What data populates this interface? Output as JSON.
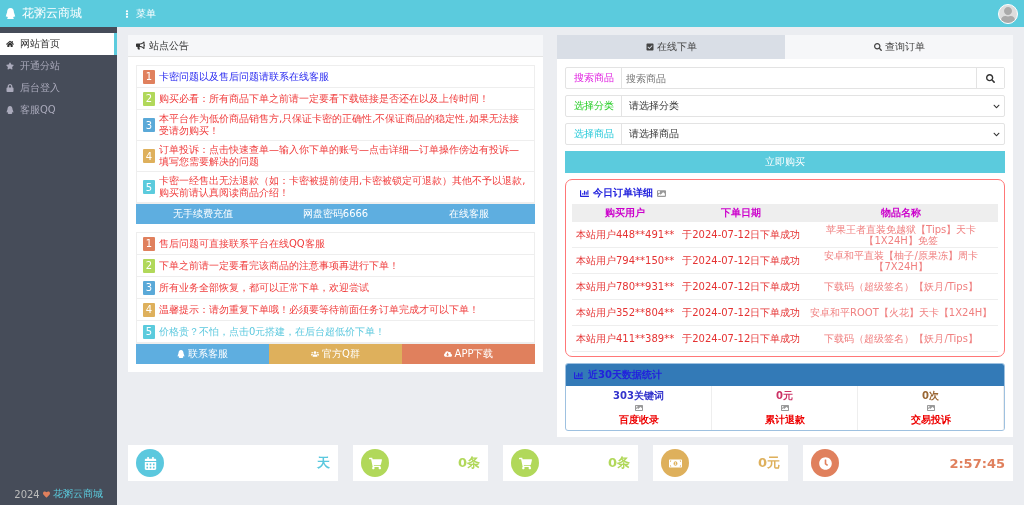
{
  "header": {
    "brand": "花粥云商城",
    "menu_label": "菜单"
  },
  "sidebar": {
    "items": [
      {
        "label": "网站首页",
        "selected": true
      },
      {
        "label": "开通分站",
        "selected": false
      },
      {
        "label": "后台登入",
        "selected": false
      },
      {
        "label": "客服QQ",
        "selected": false
      }
    ],
    "footer_year": "2024",
    "footer_link": "花粥云商城"
  },
  "notice_panel": {
    "title": "站点公告",
    "list_1": [
      {
        "number": "1",
        "text": "卡密问题以及售后问题请联系在线客服",
        "kind": "link"
      },
      {
        "number": "2",
        "text": "购买必看：所有商品下单之前请一定要看下载链接是否还在以及上传时间！",
        "kind": "warning"
      },
      {
        "number": "3",
        "text": "本平台作为低价商品销售方,只保证卡密的正确性,不保证商品的稳定性,如果无法接受请勿购买！",
        "kind": "warning"
      },
      {
        "number": "4",
        "text": "订单投诉：点击快速查单—输入你下单的账号—点击详细—订单操作傍边有投诉—填写您需要解决的问题",
        "kind": "warning"
      },
      {
        "number": "5",
        "text": "卡密一经售出无法退款（如：卡密被提前使用,卡密被锁定可退款）其他不予以退款,购买前请认真阅读商品介绍！",
        "kind": "warning"
      }
    ],
    "buttons_1": [
      "无手续费充值",
      "网盘密码6666",
      "在线客服"
    ],
    "list_2": [
      {
        "number": "1",
        "text": "售后问题可直接联系平台在线QQ客服",
        "kind": "warning"
      },
      {
        "number": "2",
        "text": "下单之前请一定要看完该商品的注意事项再进行下单！",
        "kind": "warning"
      },
      {
        "number": "3",
        "text": "所有业务全部恢复，都可以正常下单，欢迎尝试",
        "kind": "warning"
      },
      {
        "number": "4",
        "text": "温馨提示：请勿重复下单哦！必须要等待前面任务订单完成才可以下单！",
        "kind": "warning"
      },
      {
        "number": "5",
        "text": "价格贵？不怕，点击0元搭建，在后台超低价下单！",
        "kind": "tip"
      }
    ],
    "buttons_2": [
      "联系客服",
      "官方Q群",
      "APP下载"
    ]
  },
  "order_panel": {
    "tabs": [
      {
        "label": "在线下单",
        "selected": true
      },
      {
        "label": "查询订单",
        "selected": false
      }
    ],
    "search": {
      "label": "搜索商品",
      "placeholder": "搜索商品"
    },
    "category": {
      "label": "选择分类",
      "value": "请选择分类"
    },
    "product": {
      "label": "选择商品",
      "value": "请选择商品"
    },
    "buy_button": "立即购买",
    "today": {
      "title": "今日订单详细",
      "columns": [
        "购买用户",
        "下单日期",
        "物品名称"
      ],
      "rows": [
        [
          "本站用户448**491**",
          "于2024-07-12日下单成功",
          "苹果王者直装免越狱【Tips】天卡【1X24H】免签"
        ],
        [
          "本站用户794**150**",
          "于2024-07-12日下单成功",
          "安卓和平直装【柚子/原果冻】周卡【7X24H】"
        ],
        [
          "本站用户780**931**",
          "于2024-07-12日下单成功",
          "下载码（超级签名）【妖月/Tips】"
        ],
        [
          "本站用户352**804**",
          "于2024-07-12日下单成功",
          "安卓和平ROOT【火花】天卡【1X24H】"
        ],
        [
          "本站用户411**389**",
          "于2024-07-12日下单成功",
          "下载码（超级签名）【妖月/Tips】"
        ]
      ]
    },
    "stats": {
      "title": "近30天数据统计",
      "items": [
        {
          "value": "303关键词",
          "label": "百度收录"
        },
        {
          "value": "0元",
          "label": "累计退款"
        },
        {
          "value": "0次",
          "label": "交易投诉"
        }
      ]
    }
  },
  "stat_cards": [
    {
      "value": "天",
      "color": "#5bc8de"
    },
    {
      "value": "0条",
      "color": "#b1d85a"
    },
    {
      "value": "0条",
      "color": "#b1d85a"
    },
    {
      "value": "0元",
      "color": "#deb05c"
    },
    {
      "value": "2:57:45",
      "color": "#e0805d"
    }
  ]
}
